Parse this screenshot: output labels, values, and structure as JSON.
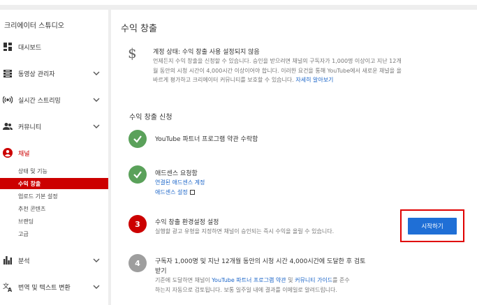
{
  "sidebar": {
    "title": "크리에이터 스튜디오",
    "items": [
      {
        "label": "대시보드",
        "icon": "dashboard-icon",
        "chevron": false
      },
      {
        "label": "동영상 관리자",
        "icon": "video-manager-icon",
        "chevron": true
      },
      {
        "label": "실시간 스트리밍",
        "icon": "live-streaming-icon",
        "chevron": true
      },
      {
        "label": "커뮤니티",
        "icon": "community-icon",
        "chevron": true
      },
      {
        "label": "채널",
        "icon": "channel-icon",
        "chevron": false,
        "active": true
      },
      {
        "label": "분석",
        "icon": "analytics-icon",
        "chevron": true
      },
      {
        "label": "번역 및 텍스트 변환",
        "icon": "translate-icon",
        "chevron": true
      }
    ],
    "channel_sub_items": [
      {
        "label": "상태 및 기능"
      },
      {
        "label": "수익 창출",
        "active": true
      },
      {
        "label": "업로드 기본 설정"
      },
      {
        "label": "추천 콘텐츠"
      },
      {
        "label": "브랜딩"
      },
      {
        "label": "고급"
      }
    ]
  },
  "main": {
    "title": "수익 창출",
    "status": {
      "title": "계정 상태: 수익 창출 사용 설정되지 않음",
      "text": "언제든지 수익 창출을 신청할 수 있습니다. 승인을 받으려면 채널의 구독자가 1,000명 이상이고 지난 12개월 동안의 시청 시간이 4,000시간 이상이어야 합니다. 이러한 요건을 통해 YouTube에서 새로운 채널을 올바르게 평가하고 크리에이터 커뮤니티를 보호할 수 있습니다.",
      "link": "자세히 알아보기"
    },
    "section_title": "수익 창출 신청",
    "steps": [
      {
        "title": "YouTube 파트너 프로그램 약관 수락함"
      },
      {
        "title": "애드센스 요청함",
        "link1": "연결된 애드센스 계정",
        "link2": "애드센스 설정"
      },
      {
        "number": "3",
        "title": "수익 창출 환경설정 설정",
        "desc": "실행할 광고 유형을 지정하면 채널이 승인되는 즉시 수익을 올릴 수 있습니다.",
        "button": "시작하기"
      },
      {
        "number": "4",
        "title_line1": "구독자 1,000명 및 지난 12개월 동안의 시청 시간 4,000시간에 도달한 후 검토",
        "title_line2": "받기",
        "desc_pre": "기준에 도달하면 채널이 ",
        "desc_link1": "YouTube 파트너 프로그램 약관",
        "desc_mid": " 및 ",
        "desc_link2": "커뮤니티 가이드",
        "desc_post": "를 준수",
        "desc_line2": "하는지 자동으로 검토됩니다. 보통 일주일 내에 결과를 이메일로 알려드립니다."
      }
    ]
  },
  "colors": {
    "accent_red": "#cc0000",
    "check_green": "#5aa15a",
    "link_blue": "#1a64c8",
    "button_blue": "#1f6fd6",
    "future_grey": "#9e9e9e"
  }
}
